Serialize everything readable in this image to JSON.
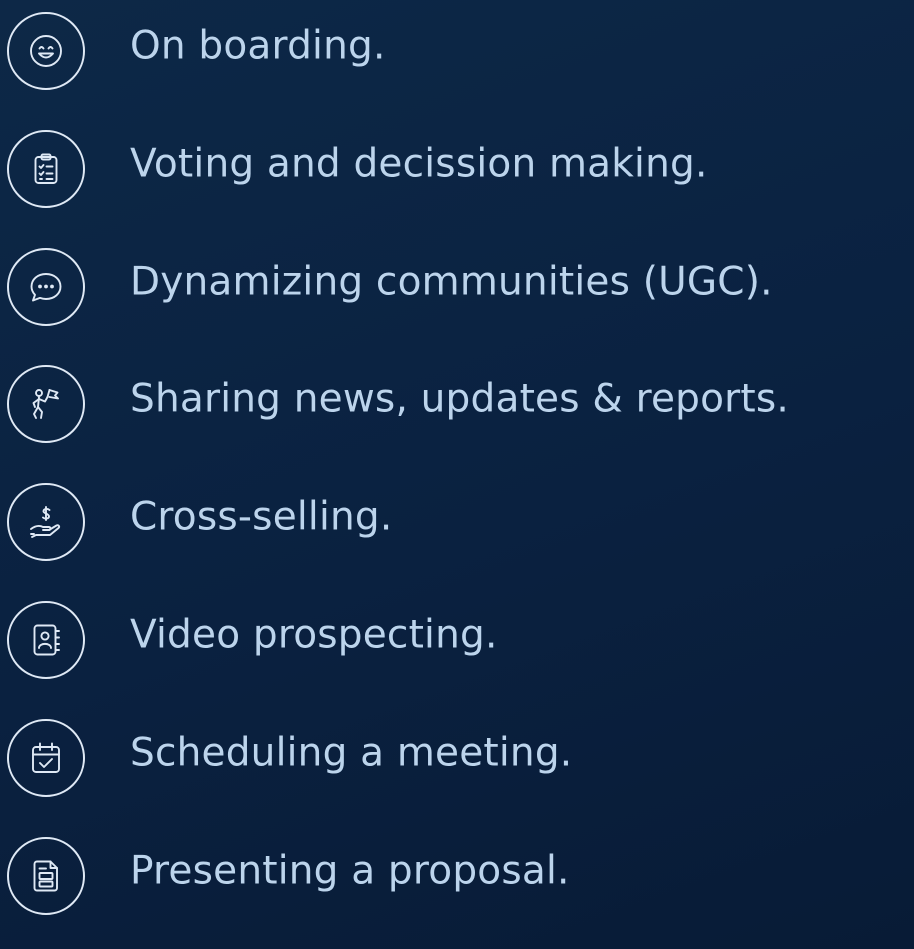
{
  "use_cases": [
    {
      "label": "On boarding.",
      "icon": "smiley-face-icon"
    },
    {
      "label": "Voting and decission making.",
      "icon": "clipboard-checklist-icon"
    },
    {
      "label": "Dynamizing communities (UGC).",
      "icon": "chat-bubble-icon"
    },
    {
      "label": "Sharing news, updates & reports.",
      "icon": "person-with-flag-icon"
    },
    {
      "label": "Cross-selling.",
      "icon": "hand-dollar-icon"
    },
    {
      "label": "Video prospecting.",
      "icon": "contact-book-icon"
    },
    {
      "label": "Scheduling a meeting.",
      "icon": "calendar-check-icon"
    },
    {
      "label": "Presenting a proposal.",
      "icon": "document-icon"
    }
  ],
  "colors": {
    "background": "#0b2342",
    "text": "#bcd4ec",
    "icon": "#dfe9f5"
  }
}
